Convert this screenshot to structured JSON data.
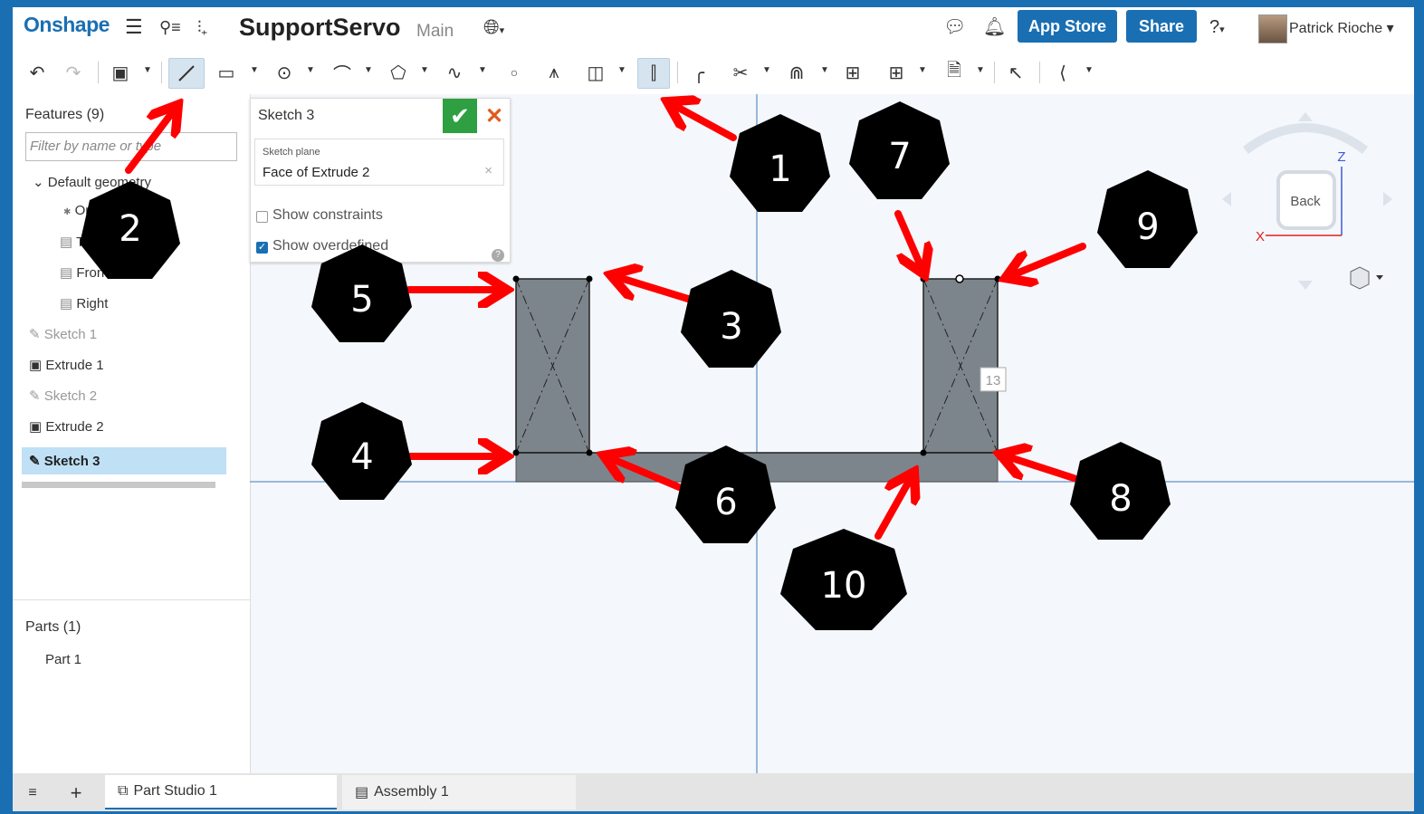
{
  "app": {
    "logo": "Onshape",
    "doc_title": "SupportServo",
    "branch": "Main"
  },
  "header": {
    "app_store": "App Store",
    "share": "Share",
    "user_name": "Patrick Rioche ▾"
  },
  "features": {
    "title": "Features (9)",
    "filter_placeholder": "Filter by name or type",
    "items": [
      {
        "label": "Default geometry",
        "icon": "chevron-down-icon"
      },
      {
        "label": "Origin",
        "icon": "origin-icon"
      },
      {
        "label": "Top",
        "icon": "plane-icon"
      },
      {
        "label": "Front",
        "icon": "plane-icon"
      },
      {
        "label": "Right",
        "icon": "plane-icon"
      },
      {
        "label": "Sketch 1",
        "icon": "sketch-icon"
      },
      {
        "label": "Extrude 1",
        "icon": "extrude-icon"
      },
      {
        "label": "Sketch 2",
        "icon": "sketch-icon"
      },
      {
        "label": "Extrude 2",
        "icon": "extrude-icon"
      },
      {
        "label": "Sketch 3",
        "icon": "sketch-icon"
      }
    ]
  },
  "parts": {
    "title": "Parts (1)",
    "items": [
      "Part 1"
    ]
  },
  "sketch_dialog": {
    "title": "Sketch 3",
    "plane_label": "Sketch plane",
    "plane_value": "Face of Extrude 2",
    "show_constraints": "Show constraints",
    "show_overdefined": "Show overdefined",
    "clear": "×"
  },
  "view_cube": {
    "face": "Back",
    "axis_x": "X",
    "axis_z": "Z"
  },
  "viewport": {
    "dimension_label": "13"
  },
  "callouts": [
    "1",
    "2",
    "3",
    "4",
    "5",
    "6",
    "7",
    "8",
    "9",
    "10"
  ],
  "tabs": [
    "Part Studio 1",
    "Assembly 1"
  ],
  "colors": {
    "brand_blue": "#1a6fb3",
    "ok_green": "#2ea042",
    "arrow_red": "#ff0000",
    "part_gray": "#7d858c"
  }
}
